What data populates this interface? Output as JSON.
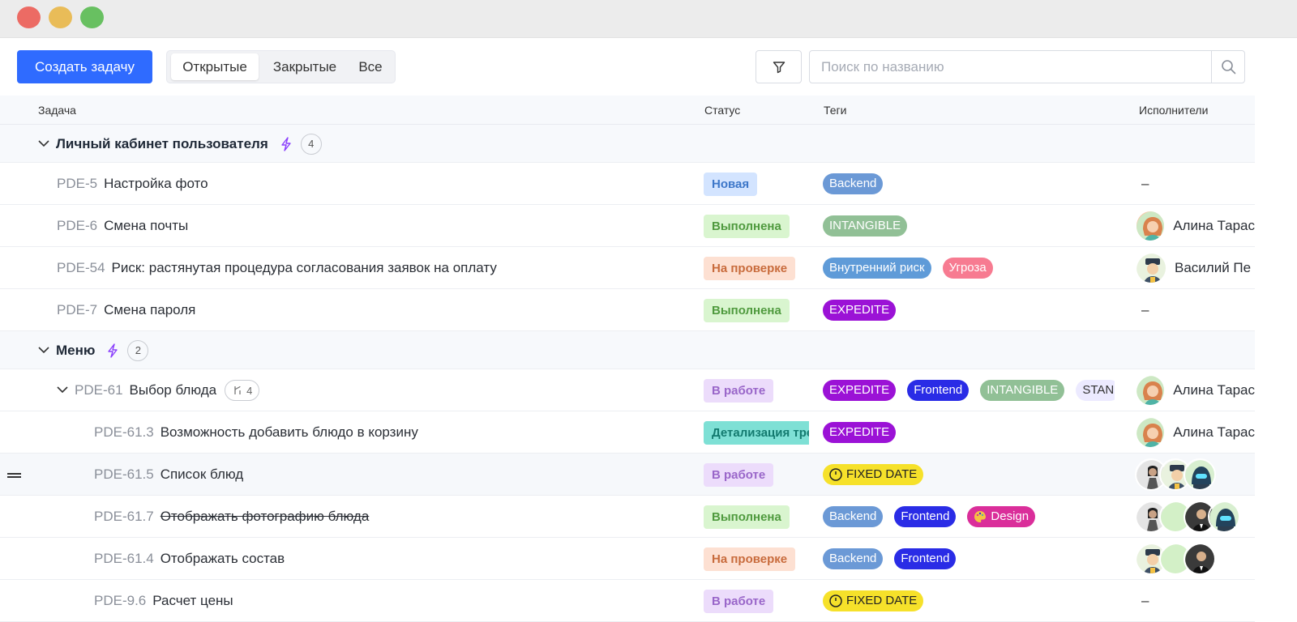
{
  "toolbar": {
    "create_label": "Создать задачу",
    "tabs": [
      {
        "label": "Открытые"
      },
      {
        "label": "Закрытые"
      },
      {
        "label": "Все"
      }
    ],
    "search_placeholder": "Поиск по названию",
    "search_value": ""
  },
  "table": {
    "headers": {
      "task": "Задача",
      "status": "Статус",
      "tags": "Теги",
      "assignees": "Исполнители"
    }
  },
  "groups": [
    {
      "title": "Личный кабинет пользователя",
      "count": "4"
    },
    {
      "title": "Меню",
      "count": "2"
    }
  ],
  "rows": [
    {
      "id": "PDE-5",
      "title": "Настройка фото",
      "status": "Новая",
      "tags": [
        "Backend"
      ],
      "assignee": "–"
    },
    {
      "id": "PDE-6",
      "title": "Смена почты",
      "status": "Выполнена",
      "tags": [
        "INTANGIBLE"
      ],
      "assignee": "Алина Тарас"
    },
    {
      "id": "PDE-54",
      "title": "Риск: растянутая процедура согласования заявок на оплату",
      "status": "На проверке",
      "tags": [
        "Внутренний риск",
        "Угроза"
      ],
      "assignee": "Василий Пе"
    },
    {
      "id": "PDE-7",
      "title": "Смена пароля",
      "status": "Выполнена",
      "tags": [
        "EXPEDITE"
      ],
      "assignee": "–"
    },
    {
      "id": "PDE-61",
      "title": "Выбор блюда",
      "subtasks": "4",
      "status": "В работе",
      "tags": [
        "EXPEDITE",
        "Frontend",
        "INTANGIBLE",
        "STAN"
      ],
      "assignee": "Алина Тарас"
    },
    {
      "id": "PDE-61.3",
      "title": "Возможность добавить блюдо в корзину",
      "status": "Детализация тре",
      "tags": [
        "EXPEDITE"
      ],
      "assignee": "Алина Тарас"
    },
    {
      "id": "PDE-61.5",
      "title": "Список блюд",
      "status": "В работе",
      "tags": [
        "FIXED DATE"
      ],
      "assignee": ""
    },
    {
      "id": "PDE-61.7",
      "title": "Отображать фотографию блюда",
      "status": "Выполнена",
      "tags": [
        "Backend",
        "Frontend",
        "Design"
      ],
      "assignee": ""
    },
    {
      "id": "PDE-61.4",
      "title": "Отображать состав",
      "status": "На проверке",
      "tags": [
        "Backend",
        "Frontend"
      ],
      "assignee": ""
    },
    {
      "id": "PDE-9.6",
      "title": "Расчет цены",
      "status": "В работе",
      "tags": [
        "FIXED DATE"
      ],
      "assignee": "–"
    }
  ],
  "colors": {
    "accent": "#2f6bff",
    "expedite": "#9b12d6",
    "frontend": "#2a2ce6"
  }
}
